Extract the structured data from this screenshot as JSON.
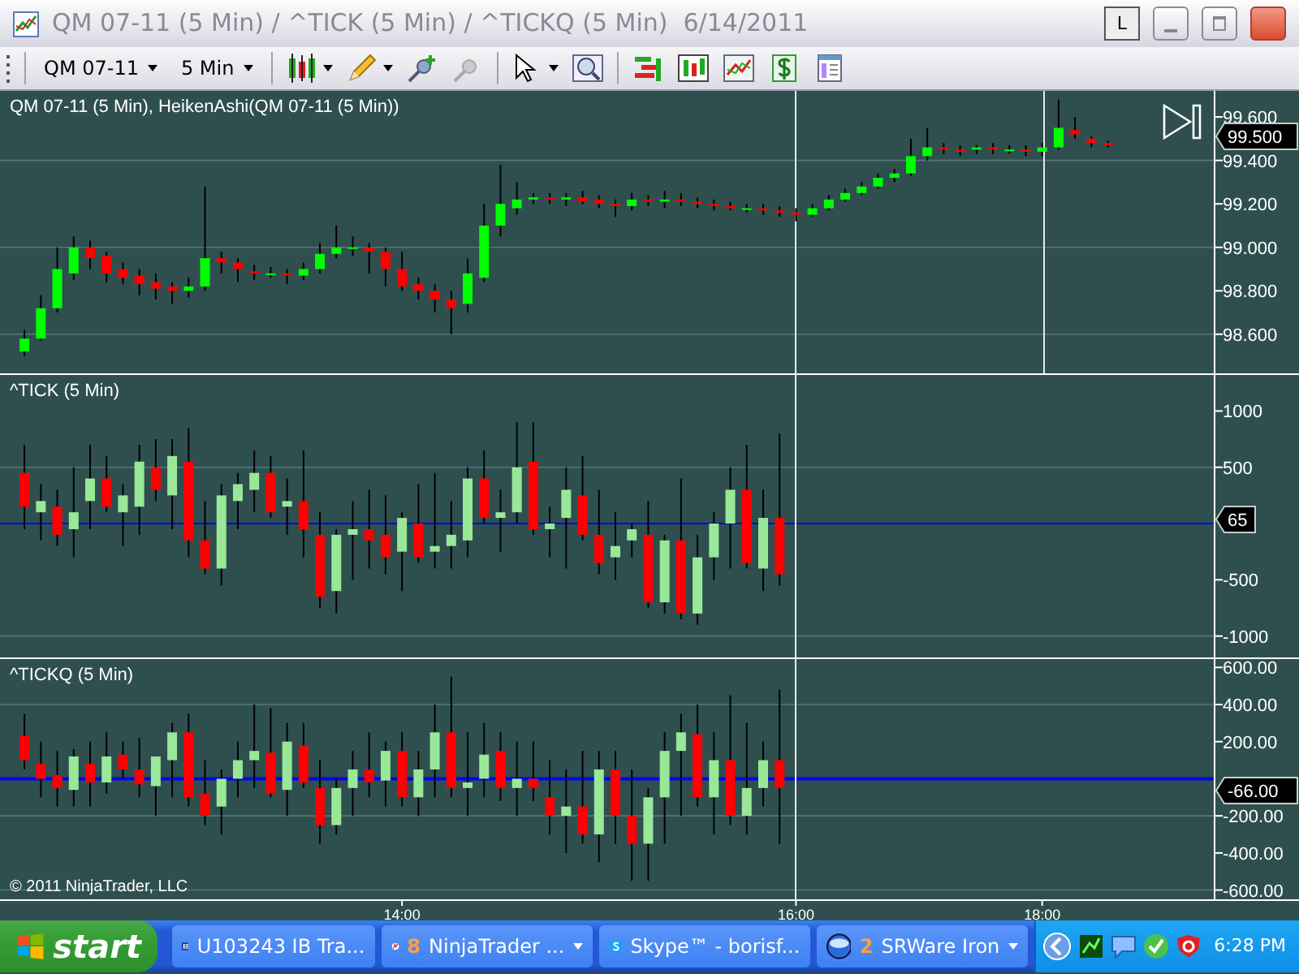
{
  "window": {
    "title": "QM 07-11 (5 Min) / ^TICK (5 Min) / ^TICKQ (5 Min)  6/14/2011",
    "mode_button": "L"
  },
  "toolbar": {
    "instrument": "QM 07-11",
    "interval": "5 Min"
  },
  "panels": [
    {
      "kind": "price",
      "label": "QM 07-11 (5 Min), HeikenAshi(QM 07-11 (5 Min))",
      "marker": "99.500",
      "chart_data": {
        "type": "candlestick",
        "grid": true,
        "ylim": [
          98.42,
          99.72
        ],
        "yticks": [
          {
            "value": 99.6,
            "label": "99.600"
          },
          {
            "value": 99.4,
            "label": "99.400"
          },
          {
            "value": 99.2,
            "label": "99.200"
          },
          {
            "value": 99.0,
            "label": "99.000"
          },
          {
            "value": 98.8,
            "label": "98.800"
          },
          {
            "value": 98.6,
            "label": "98.600"
          }
        ],
        "categories": [
          null,
          null,
          null,
          null,
          null,
          null,
          null,
          null,
          null,
          null,
          null,
          null,
          null,
          null,
          null,
          null,
          null,
          null,
          null,
          null,
          null,
          null,
          null,
          null,
          null,
          null,
          null,
          null,
          null,
          null,
          null,
          null,
          null,
          null,
          null,
          null,
          null,
          null,
          null,
          null,
          null,
          null,
          null,
          null,
          null,
          null,
          null,
          null,
          null,
          null,
          null,
          null,
          null,
          null,
          null,
          null,
          null,
          null,
          null,
          null,
          null,
          null,
          null,
          null,
          null,
          null,
          null,
          null,
          null,
          null,
          null,
          null,
          null
        ],
        "ohlc": [
          [
            98.52,
            98.62,
            98.5,
            98.58
          ],
          [
            98.58,
            98.78,
            98.57,
            98.72
          ],
          [
            98.72,
            99.0,
            98.7,
            98.9
          ],
          [
            98.88,
            99.05,
            98.85,
            99.0
          ],
          [
            99.0,
            99.03,
            98.9,
            98.95
          ],
          [
            98.96,
            98.98,
            98.84,
            98.88
          ],
          [
            98.9,
            98.93,
            98.83,
            98.86
          ],
          [
            98.87,
            98.9,
            98.78,
            98.83
          ],
          [
            98.84,
            98.88,
            98.76,
            98.81
          ],
          [
            98.82,
            98.84,
            98.74,
            98.8
          ],
          [
            98.8,
            98.86,
            98.77,
            98.82
          ],
          [
            98.82,
            99.28,
            98.8,
            98.95
          ],
          [
            98.95,
            98.98,
            98.88,
            98.93
          ],
          [
            98.93,
            98.95,
            98.84,
            98.9
          ],
          [
            98.89,
            98.92,
            98.85,
            98.88
          ],
          [
            98.88,
            98.91,
            98.86,
            98.88
          ],
          [
            98.88,
            98.9,
            98.83,
            98.87
          ],
          [
            98.87,
            98.93,
            98.85,
            98.9
          ],
          [
            98.9,
            99.02,
            98.88,
            98.97
          ],
          [
            98.97,
            99.1,
            98.95,
            99.0
          ],
          [
            99.0,
            99.05,
            98.96,
            99.0
          ],
          [
            99.0,
            99.02,
            98.88,
            98.98
          ],
          [
            98.98,
            99.0,
            98.82,
            98.9
          ],
          [
            98.9,
            98.98,
            98.8,
            98.82
          ],
          [
            98.83,
            98.86,
            98.76,
            98.8
          ],
          [
            98.8,
            98.83,
            98.7,
            98.76
          ],
          [
            98.76,
            98.8,
            98.6,
            98.72
          ],
          [
            98.74,
            98.95,
            98.7,
            98.88
          ],
          [
            98.86,
            99.2,
            98.84,
            99.1
          ],
          [
            99.1,
            99.38,
            99.05,
            99.2
          ],
          [
            99.18,
            99.3,
            99.15,
            99.22
          ],
          [
            99.22,
            99.25,
            99.2,
            99.23
          ],
          [
            99.23,
            99.25,
            99.2,
            99.22
          ],
          [
            99.22,
            99.25,
            99.19,
            99.23
          ],
          [
            99.23,
            99.26,
            99.2,
            99.21
          ],
          [
            99.22,
            99.24,
            99.18,
            99.2
          ],
          [
            99.2,
            99.22,
            99.14,
            99.19
          ],
          [
            99.19,
            99.25,
            99.17,
            99.22
          ],
          [
            99.22,
            99.24,
            99.19,
            99.21
          ],
          [
            99.21,
            99.26,
            99.18,
            99.22
          ],
          [
            99.22,
            99.25,
            99.19,
            99.21
          ],
          [
            99.21,
            99.23,
            99.18,
            99.2
          ],
          [
            99.2,
            99.22,
            99.17,
            99.19
          ],
          [
            99.19,
            99.21,
            99.17,
            99.18
          ],
          [
            99.18,
            99.2,
            99.16,
            99.18
          ],
          [
            99.18,
            99.2,
            99.15,
            99.17
          ],
          [
            99.17,
            99.19,
            99.14,
            99.16
          ],
          [
            99.16,
            99.18,
            99.12,
            99.15
          ],
          [
            99.15,
            99.2,
            99.14,
            99.18
          ],
          [
            99.18,
            99.24,
            99.17,
            99.22
          ],
          [
            99.22,
            99.27,
            99.21,
            99.25
          ],
          [
            99.25,
            99.3,
            99.24,
            99.28
          ],
          [
            99.28,
            99.34,
            99.27,
            99.32
          ],
          [
            99.32,
            99.36,
            99.3,
            99.34
          ],
          [
            99.34,
            99.5,
            99.33,
            99.42
          ],
          [
            99.42,
            99.55,
            99.4,
            99.46
          ],
          [
            99.46,
            99.48,
            99.43,
            99.45
          ],
          [
            99.45,
            99.47,
            99.42,
            99.44
          ],
          [
            99.45,
            99.47,
            99.43,
            99.46
          ],
          [
            99.46,
            99.48,
            99.43,
            99.45
          ],
          [
            99.45,
            99.47,
            99.43,
            99.45
          ],
          [
            99.45,
            99.47,
            99.42,
            99.44
          ],
          [
            99.44,
            99.48,
            99.42,
            99.46
          ],
          [
            99.46,
            99.68,
            99.45,
            99.55
          ],
          [
            99.54,
            99.6,
            99.5,
            99.52
          ],
          [
            99.5,
            99.51,
            99.46,
            99.48
          ],
          [
            99.48,
            99.49,
            99.46,
            99.47
          ],
          null,
          null,
          null,
          null,
          null,
          null
        ]
      }
    },
    {
      "kind": "tick",
      "label": "^TICK (5 Min)",
      "marker": "65",
      "chart_data": {
        "type": "candlestick",
        "grid": true,
        "ylim": [
          -1190,
          1320
        ],
        "yticks": [
          {
            "value": 1000,
            "label": "1000"
          },
          {
            "value": 500,
            "label": "500"
          },
          {
            "value": -500,
            "label": "-500"
          },
          {
            "value": -1000,
            "label": "-1000"
          }
        ],
        "categories": [
          null,
          null,
          null,
          null,
          null,
          null,
          null,
          null,
          null,
          null,
          null,
          null,
          null,
          null,
          null,
          null,
          null,
          null,
          null,
          null,
          null,
          null,
          null,
          null,
          null,
          null,
          null,
          null,
          null,
          null,
          null,
          null,
          null,
          null,
          null,
          null,
          null,
          null,
          null,
          null,
          null,
          null,
          null,
          null,
          null,
          null,
          null,
          null,
          null,
          null,
          null,
          null,
          null,
          null,
          null,
          null,
          null,
          null,
          null,
          null,
          null,
          null,
          null,
          null,
          null,
          null,
          null,
          null,
          null,
          null,
          null,
          null,
          null
        ],
        "ohlc": [
          [
            450,
            700,
            -50,
            150
          ],
          [
            100,
            350,
            -150,
            200
          ],
          [
            150,
            300,
            -200,
            -100
          ],
          [
            -50,
            500,
            -300,
            100
          ],
          [
            200,
            700,
            -50,
            400
          ],
          [
            400,
            600,
            100,
            150
          ],
          [
            100,
            350,
            -200,
            250
          ],
          [
            150,
            700,
            -100,
            550
          ],
          [
            500,
            750,
            200,
            300
          ],
          [
            250,
            750,
            -50,
            600
          ],
          [
            550,
            850,
            -300,
            -150
          ],
          [
            -150,
            200,
            -450,
            -400
          ],
          [
            -400,
            350,
            -550,
            250
          ],
          [
            200,
            450,
            -50,
            350
          ],
          [
            300,
            650,
            100,
            450
          ],
          [
            450,
            600,
            50,
            100
          ],
          [
            150,
            400,
            -100,
            200
          ],
          [
            200,
            650,
            -300,
            -50
          ],
          [
            -100,
            100,
            -750,
            -650
          ],
          [
            -600,
            -50,
            -800,
            -100
          ],
          [
            -100,
            200,
            -500,
            -50
          ],
          [
            -50,
            300,
            -400,
            -150
          ],
          [
            -100,
            250,
            -450,
            -300
          ],
          [
            -250,
            100,
            -600,
            50
          ],
          [
            0,
            350,
            -350,
            -300
          ],
          [
            -250,
            450,
            -400,
            -200
          ],
          [
            -200,
            200,
            -400,
            -100
          ],
          [
            -150,
            500,
            -300,
            400
          ],
          [
            400,
            650,
            0,
            50
          ],
          [
            50,
            300,
            -250,
            100
          ],
          [
            100,
            900,
            0,
            500
          ],
          [
            550,
            900,
            -100,
            -50
          ],
          [
            -50,
            150,
            -300,
            0
          ],
          [
            50,
            500,
            -400,
            300
          ],
          [
            250,
            600,
            -150,
            -100
          ],
          [
            -100,
            300,
            -450,
            -350
          ],
          [
            -300,
            100,
            -500,
            -200
          ],
          [
            -150,
            0,
            -300,
            -50
          ],
          [
            -100,
            200,
            -750,
            -700
          ],
          [
            -700,
            -100,
            -800,
            -150
          ],
          [
            -150,
            400,
            -850,
            -800
          ],
          [
            -800,
            -100,
            -900,
            -300
          ],
          [
            -300,
            100,
            -500,
            0
          ],
          [
            0,
            500,
            -400,
            300
          ],
          [
            300,
            700,
            -400,
            -350
          ],
          [
            -400,
            300,
            -600,
            50
          ],
          [
            50,
            800,
            -550,
            -450
          ],
          null,
          null,
          null,
          null,
          null,
          null,
          null,
          null,
          null,
          null,
          null,
          null,
          null,
          null,
          null,
          null,
          null,
          null,
          null,
          null,
          null,
          null,
          null,
          null,
          null,
          null
        ]
      }
    },
    {
      "kind": "tick",
      "label": "^TICKQ (5 Min)",
      "marker": "-66.00",
      "chart_data": {
        "type": "candlestick",
        "grid": true,
        "ylim": [
          -650,
          645
        ],
        "yticks": [
          {
            "value": 600,
            "label": "600.00"
          },
          {
            "value": 400,
            "label": "400.00"
          },
          {
            "value": 200,
            "label": "200.00"
          },
          {
            "value": -200,
            "label": "-200.00"
          },
          {
            "value": -400,
            "label": "-400.00"
          },
          {
            "value": -600,
            "label": "-600.00"
          }
        ],
        "categories": [
          null,
          null,
          null,
          null,
          null,
          null,
          null,
          null,
          null,
          null,
          null,
          null,
          null,
          null,
          null,
          null,
          null,
          null,
          null,
          null,
          null,
          null,
          null,
          "14:00",
          null,
          null,
          null,
          null,
          null,
          null,
          null,
          null,
          null,
          null,
          null,
          null,
          null,
          null,
          null,
          null,
          null,
          null,
          null,
          null,
          null,
          null,
          null,
          "16:00",
          null,
          null,
          null,
          null,
          null,
          null,
          null,
          null,
          null,
          null,
          null,
          null,
          null,
          null,
          "18:00",
          null,
          null,
          null,
          null,
          null,
          null,
          null,
          null,
          null,
          null
        ],
        "ohlc": [
          [
            230,
            350,
            50,
            100
          ],
          [
            80,
            200,
            -100,
            0
          ],
          [
            20,
            150,
            -150,
            -50
          ],
          [
            -60,
            160,
            -150,
            120
          ],
          [
            80,
            200,
            -150,
            -20
          ],
          [
            -20,
            250,
            -80,
            120
          ],
          [
            130,
            200,
            0,
            50
          ],
          [
            50,
            220,
            -100,
            -30
          ],
          [
            -40,
            120,
            -200,
            120
          ],
          [
            100,
            300,
            -100,
            250
          ],
          [
            250,
            350,
            -150,
            -100
          ],
          [
            -80,
            100,
            -250,
            -200
          ],
          [
            -150,
            50,
            -300,
            0
          ],
          [
            0,
            200,
            -100,
            100
          ],
          [
            100,
            400,
            -50,
            150
          ],
          [
            140,
            380,
            -100,
            -80
          ],
          [
            -60,
            300,
            -200,
            200
          ],
          [
            180,
            300,
            -50,
            -20
          ],
          [
            -50,
            100,
            -350,
            -250
          ],
          [
            -250,
            0,
            -300,
            -50
          ],
          [
            -50,
            150,
            -200,
            50
          ],
          [
            50,
            250,
            -100,
            -20
          ],
          [
            -10,
            200,
            -150,
            150
          ],
          [
            150,
            250,
            -150,
            -100
          ],
          [
            -100,
            150,
            -200,
            50
          ],
          [
            50,
            400,
            -100,
            250
          ],
          [
            250,
            550,
            -100,
            -50
          ],
          [
            -50,
            250,
            -200,
            -20
          ],
          [
            0,
            300,
            -100,
            130
          ],
          [
            150,
            250,
            -120,
            -50
          ],
          [
            -50,
            200,
            -200,
            0
          ],
          [
            0,
            200,
            -120,
            -50
          ],
          [
            -100,
            100,
            -300,
            -200
          ],
          [
            -200,
            50,
            -400,
            -150
          ],
          [
            -150,
            150,
            -350,
            -300
          ],
          [
            -300,
            150,
            -450,
            50
          ],
          [
            50,
            150,
            -350,
            -200
          ],
          [
            -200,
            50,
            -550,
            -350
          ],
          [
            -350,
            -50,
            -550,
            -100
          ],
          [
            -100,
            250,
            -350,
            150
          ],
          [
            150,
            350,
            -200,
            250
          ],
          [
            240,
            400,
            -150,
            -100
          ],
          [
            -100,
            250,
            -300,
            100
          ],
          [
            100,
            450,
            -250,
            -200
          ],
          [
            -200,
            300,
            -300,
            -50
          ],
          [
            -50,
            200,
            -150,
            100
          ],
          [
            100,
            480,
            -350,
            -50
          ],
          null,
          null,
          null,
          null,
          null,
          null,
          null,
          null,
          null,
          null,
          null,
          null,
          null,
          null,
          null,
          null,
          null,
          null,
          null,
          null,
          null,
          null,
          null,
          null,
          null,
          null
        ]
      }
    }
  ],
  "copyright": "© 2011 NinjaTrader, LLC",
  "taskbar": {
    "start": "start",
    "tasks": [
      {
        "label": "U103243 IB Tra...",
        "grouped": false
      },
      {
        "count": "8",
        "label": "NinjaTrader ...",
        "grouped": true
      },
      {
        "label": "Skype™ - borisf...",
        "grouped": false
      },
      {
        "count": "2",
        "label": "SRWare Iron",
        "grouped": true
      }
    ],
    "clock": "6:28 PM"
  }
}
